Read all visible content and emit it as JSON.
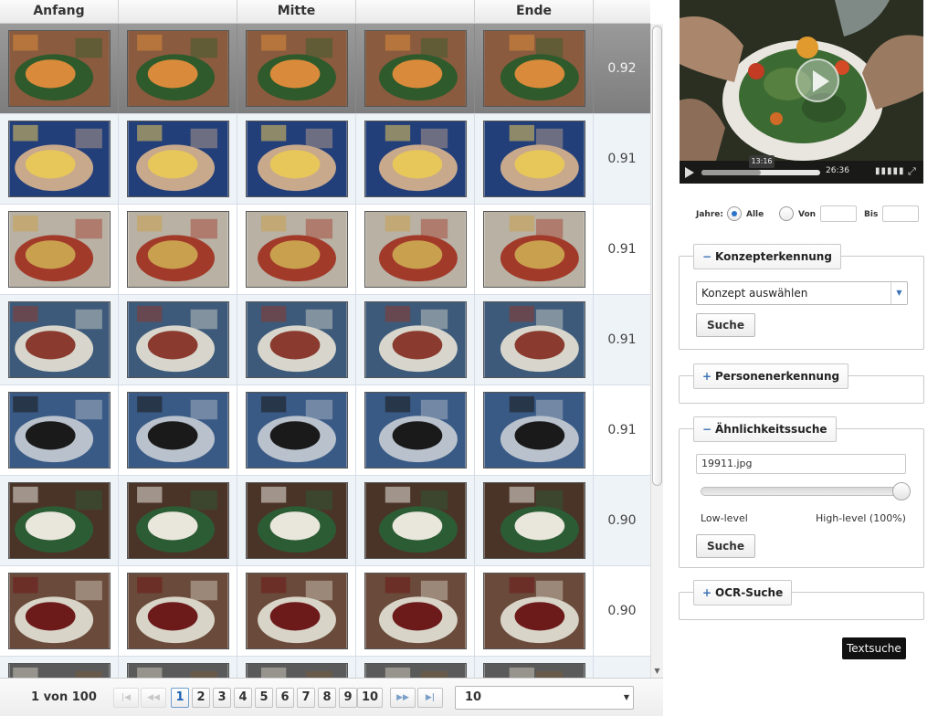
{
  "grid": {
    "headers": [
      "Anfang",
      "",
      "Mitte",
      "",
      "Ende",
      ""
    ],
    "rows": [
      {
        "score": "0.92",
        "palette": [
          "#8a5b3e",
          "#d98a3a",
          "#2f5a2c"
        ]
      },
      {
        "score": "0.91",
        "palette": [
          "#233f7a",
          "#e7c75a",
          "#c8a98c"
        ]
      },
      {
        "score": "0.91",
        "palette": [
          "#b8b1a4",
          "#c9a04e",
          "#a23a2a"
        ]
      },
      {
        "score": "0.91",
        "palette": [
          "#3d5a7a",
          "#8a3a2e",
          "#d8d6cc"
        ]
      },
      {
        "score": "0.91",
        "palette": [
          "#3a5a86",
          "#1a1a1a",
          "#b9c2cc"
        ]
      },
      {
        "score": "0.90",
        "palette": [
          "#4a3428",
          "#e9e6dc",
          "#2c5c34"
        ]
      },
      {
        "score": "0.90",
        "palette": [
          "#6a4a3a",
          "#6d1a1a",
          "#d8d4c8"
        ]
      },
      {
        "score": "",
        "palette": [
          "#5a5a5a",
          "#c9c4b8",
          "#7a5a3a"
        ]
      }
    ]
  },
  "pager": {
    "info": "1 von 100",
    "first": "|◀",
    "prev": "◀◀",
    "pages": [
      "1",
      "2",
      "3",
      "4",
      "5",
      "6",
      "7",
      "8",
      "9",
      "10"
    ],
    "next": "▶▶",
    "last": "▶|",
    "page_size": "10"
  },
  "player": {
    "current_time": "13:16",
    "duration": "26:36",
    "progress": 0.5
  },
  "years": {
    "label": "Jahre:",
    "all": "Alle",
    "from": "Von",
    "to": "Bis"
  },
  "concept": {
    "title": "Konzepterkennung",
    "sign": "−",
    "select_value": "Konzept auswählen",
    "button": "Suche"
  },
  "person": {
    "title": "Personenerkennung",
    "sign": "+"
  },
  "similarity": {
    "title": "Ähnlichkeitssuche",
    "sign": "−",
    "file": "19911.jpg",
    "low": "Low-level",
    "high": "High-level (100%)",
    "level": 1.0,
    "button": "Suche"
  },
  "ocr": {
    "title": "OCR-Suche",
    "sign": "+"
  },
  "tooltip": "Textsuche",
  "icons": {
    "play": "play-icon",
    "volume": "volume-icon",
    "fullscreen": "fullscreen-icon"
  }
}
